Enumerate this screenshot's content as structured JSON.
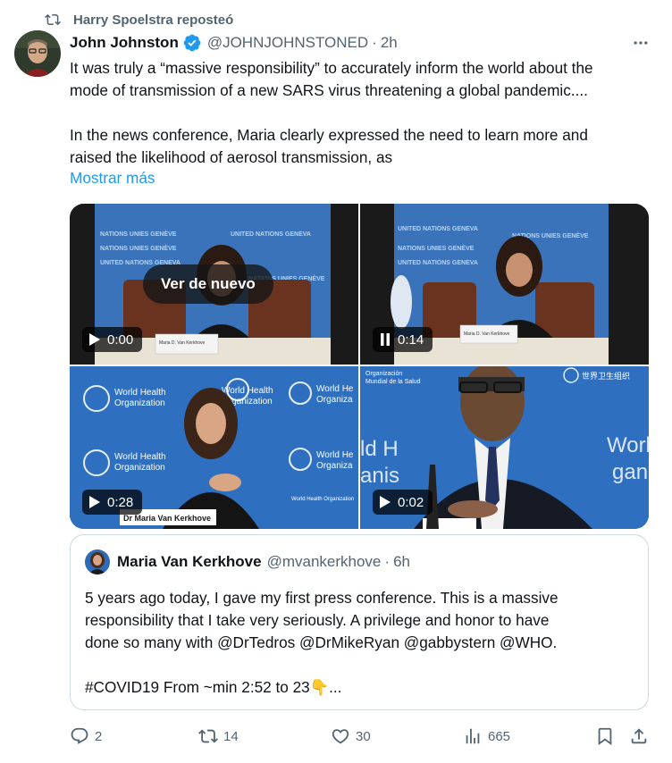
{
  "repost_line": {
    "text": "Harry Spoelstra reposteó"
  },
  "tweet": {
    "author_name": "John Johnston",
    "author_handle": "@JOHNJOHNSTONED",
    "separator": "·",
    "time": "2h",
    "text_line1": "It was truly a “massive responsibility” to accurately inform the world about the",
    "text_line2": "mode of transmission of a new SARS virus threatening a global pandemic....",
    "text_line3": "In the news conference, Maria clearly expressed the need to learn more and",
    "text_line4": "raised the likelihood of aerosol transmission, as",
    "show_more": "Mostrar más"
  },
  "media": {
    "videos": [
      {
        "time": "0:00",
        "state": "play",
        "overlay": "Ver de nuevo"
      },
      {
        "time": "0:14",
        "state": "pause"
      },
      {
        "time": "0:28",
        "state": "play"
      },
      {
        "time": "0:02",
        "state": "play"
      }
    ],
    "captions": {
      "un_banner": "NATIONS UNIES GENÈVE",
      "un_banner2": "UNITED NATIONS GENEVA",
      "who_logo_line1": "World Health",
      "who_logo_line2": "Organization",
      "who_logo_part1": "World He",
      "who_logo_part2": "Organiza",
      "who_logo_part3": "World Health",
      "who_logo_part4": "Organization",
      "who_small": "World Health Organization",
      "lower_third": "Dr Maria Van Kerkhove",
      "nameplate": "Maria D. Van Kerkhove",
      "who_fr1": "Organización",
      "who_fr2": "Mundial de la Salud",
      "who_cn": "世界卫生组织",
      "who_big1": "ld H",
      "who_big2": "anis",
      "who_big3": "World",
      "who_big4": "gan"
    }
  },
  "quote": {
    "author_name": "Maria Van Kerkhove",
    "author_handle": "@mvankerkhove",
    "separator": "·",
    "time": "6h",
    "line1": "5 years ago today, I gave my first press conference. This is a massive",
    "line2": "responsibility that I take very seriously. A privilege and honor to have",
    "line3": "done so many with @DrTedros @DrMikeRyan @gabbystern @WHO.",
    "line4": "#COVID19  From ~min 2:52 to 23👇..."
  },
  "actions": {
    "replies": "2",
    "reposts": "14",
    "likes": "30",
    "views": "665"
  },
  "icons": {
    "repost": "repost-icon",
    "verified": "verified-badge-icon",
    "more": "more-icon",
    "reply": "reply-icon",
    "like": "heart-icon",
    "views": "views-icon",
    "bookmark": "bookmark-icon",
    "share": "share-icon",
    "play": "play-icon",
    "pause": "pause-icon"
  },
  "colors": {
    "accent": "#1d9bf0",
    "secondary_text": "#536471",
    "primary_text": "#0f1419",
    "border": "#cfd9de"
  }
}
